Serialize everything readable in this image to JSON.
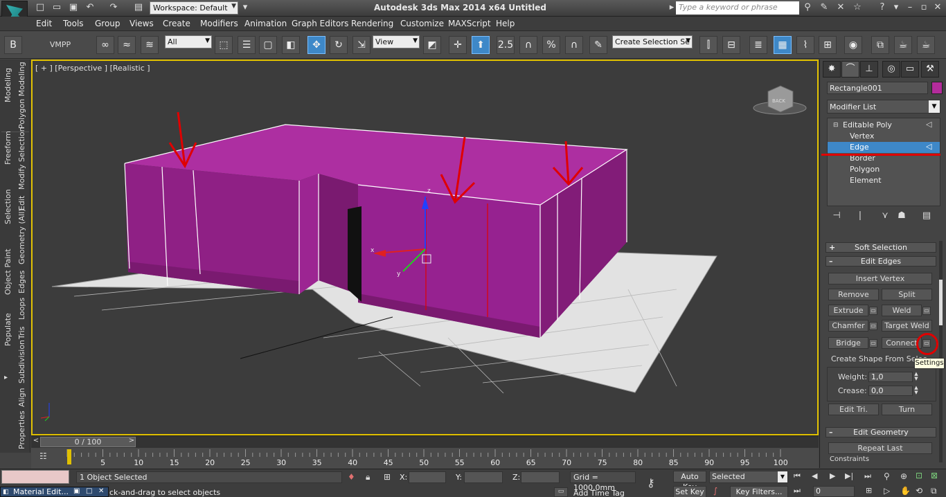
{
  "window": {
    "title": "Autodesk 3ds Max  2014 x64      Untitled",
    "workspace": "Workspace: Default",
    "search_placeholder": "Type a keyword or phrase"
  },
  "menu": [
    "Edit",
    "Tools",
    "Group",
    "Views",
    "Create",
    "Modifiers",
    "Animation",
    "Graph Editors",
    "Rendering",
    "Customize",
    "MAXScript",
    "Help"
  ],
  "toolbar": {
    "vmpp_label": "VMPP",
    "selection_filter": "All",
    "ref_coord": "View",
    "snap_value": "2.5",
    "named_selection_placeholder": "Create Selection Se"
  },
  "ribbon_tabs": [
    "Modeling",
    "Polygon Modeling",
    "Freeform",
    "Modify Selection",
    "Selection",
    "Edit",
    "Object Paint",
    "Geometry (All)",
    "Populate",
    "Edges",
    "Loops",
    "Tris",
    "Subdivision",
    "Align",
    "Properties"
  ],
  "viewport": {
    "label": "[ + ] [Perspective ] [Realistic ]",
    "viewcube_label": "BACK",
    "gizmo_axes": [
      "z",
      "x",
      "y"
    ],
    "object_color": "#b42c9c"
  },
  "time_slider": {
    "position": "0 / 100",
    "ticks": [
      "5",
      "10",
      "15",
      "20",
      "25",
      "30",
      "35",
      "40",
      "45",
      "50",
      "55",
      "60",
      "65",
      "70",
      "75",
      "80",
      "85",
      "90",
      "95",
      "100"
    ]
  },
  "command_panel": {
    "object_name": "Rectangle001",
    "object_color": "#b42c9c",
    "modifier_list": "Modifier List",
    "stack": [
      {
        "label": "Editable Poly",
        "root": true
      },
      {
        "label": "Vertex"
      },
      {
        "label": "Edge",
        "selected": true
      },
      {
        "label": "Border"
      },
      {
        "label": "Polygon"
      },
      {
        "label": "Element"
      }
    ],
    "rollouts": {
      "soft_selection": "Soft Selection",
      "edit_edges": "Edit Edges",
      "edit_geometry": "Edit Geometry"
    },
    "edit_edges": {
      "insert_vertex": "Insert Vertex",
      "remove": "Remove",
      "split": "Split",
      "extrude": "Extrude",
      "weld": "Weld",
      "chamfer": "Chamfer",
      "target_weld": "Target Weld",
      "bridge": "Bridge",
      "connect": "Connect",
      "create_shape": "Create Shape From Selec",
      "weight_label": "Weight:",
      "weight_value": "1,0",
      "crease_label": "Crease:",
      "crease_value": "0,0",
      "edit_tri": "Edit Tri.",
      "turn": "Turn"
    },
    "edit_geometry": {
      "repeat_last": "Repeat Last",
      "constraints": "Constraints"
    },
    "tooltip": "Settings"
  },
  "status": {
    "objects_selected": "1 Object Selected",
    "x_label": "X:",
    "y_label": "Y:",
    "z_label": "Z:",
    "grid": "Grid = 1000,0mm",
    "auto_key": "Auto Key",
    "selected_drop": "Selected",
    "set_key": "Set Key",
    "key_filters": "Key Filters...",
    "frame": "0",
    "add_time_tag": "Add Time Tag",
    "prompt": "ck-and-drag to select objects",
    "taskbar_item": "Material Edit..."
  }
}
